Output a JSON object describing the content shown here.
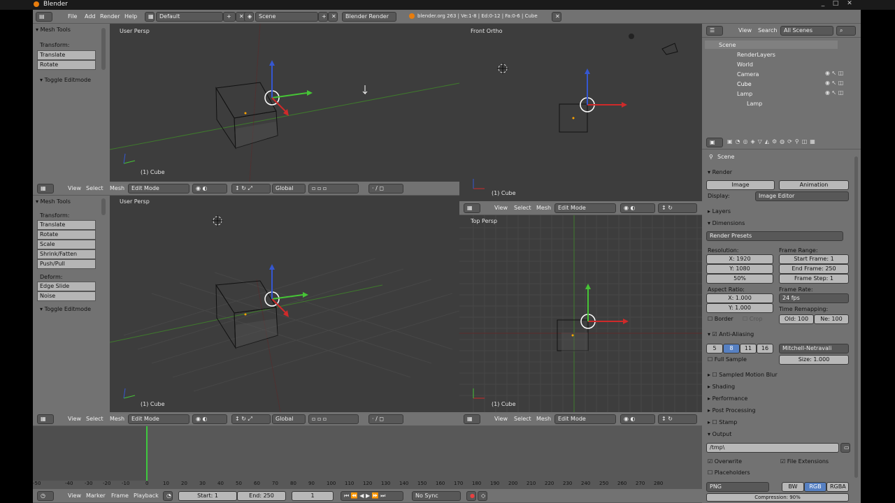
{
  "window": {
    "title": "Blender",
    "controls": [
      "_",
      "□",
      "✕"
    ]
  },
  "info_header": {
    "menus": [
      "File",
      "Add",
      "Render",
      "Help"
    ],
    "layout": "Default",
    "scene": "Scene",
    "engine": "Blender Render",
    "stats": "blender.org 263 | Ve:1-8 | Ed:0-12 | Fa:0-6 | Cube"
  },
  "viewport_tl": {
    "label": "User Persp",
    "object": "(1) Cube",
    "panel_title": "Mesh Tools",
    "transform_label": "Transform:",
    "buttons": [
      "Translate",
      "Rotate"
    ],
    "toggle": "Toggle Editmode"
  },
  "viewport_bl": {
    "label": "User Persp",
    "object": "(1) Cube",
    "panel_title": "Mesh Tools",
    "transform_label": "Transform:",
    "buttons": [
      "Translate",
      "Rotate",
      "Scale",
      "Shrink/Fatten",
      "Push/Pull"
    ],
    "deform_label": "Deform:",
    "deform_buttons": [
      "Edge Slide",
      "Noise"
    ],
    "toggle": "Toggle Editmode"
  },
  "viewport_tr": {
    "label": "Front Ortho",
    "object": "(1) Cube"
  },
  "viewport_br": {
    "label": "Top Persp",
    "object": "(1) Cube"
  },
  "vp_header": {
    "menus": [
      "View",
      "Select",
      "Mesh"
    ],
    "mode": "Edit Mode",
    "orientation": "Global"
  },
  "outliner": {
    "menus": [
      "View",
      "Search"
    ],
    "filter": "All Scenes",
    "items": [
      "Scene",
      "RenderLayers",
      "World",
      "Camera",
      "Cube",
      "Lamp",
      "Lamp"
    ]
  },
  "properties": {
    "context": "Scene",
    "render_title": "Render",
    "image_btn": "Image",
    "animation_btn": "Animation",
    "display_label": "Display:",
    "display_value": "Image Editor",
    "layers": "Layers",
    "dimensions": "Dimensions",
    "presets": "Render Presets",
    "resolution_label": "Resolution:",
    "res_x": "X: 1920",
    "res_y": "Y: 1080",
    "res_pct": "50%",
    "frame_range_label": "Frame Range:",
    "start_frame": "Start Frame: 1",
    "end_frame": "End Frame: 250",
    "frame_step": "Frame Step: 1",
    "aspect_label": "Aspect Ratio:",
    "asp_x": "X: 1.000",
    "asp_y": "Y: 1.000",
    "frame_rate_label": "Frame Rate:",
    "fps": "24 fps",
    "time_remap": "Time Remapping:",
    "border": "Border",
    "crop": "Crop",
    "old": "Old: 100",
    "new": "Ne: 100",
    "antialias": "Anti-Aliasing",
    "aa_samples": [
      "5",
      "8",
      "11",
      "16"
    ],
    "filter": "Mitchell-Netravali",
    "full_sample": "Full Sample",
    "size": "Size: 1.000",
    "sections": [
      "Sampled Motion Blur",
      "Shading",
      "Performance",
      "Post Processing",
      "Stamp",
      "Output"
    ],
    "output_path": "/tmp\\",
    "overwrite": "Overwrite",
    "file_ext": "File Extensions",
    "placeholders": "Placeholders",
    "format": "PNG",
    "color_modes": [
      "BW",
      "RGB",
      "RGBA"
    ],
    "compression": "Compression: 90%"
  },
  "timeline": {
    "ticks": [
      "-50",
      "-40",
      "-30",
      "-20",
      "-10",
      "0",
      "10",
      "20",
      "30",
      "40",
      "50",
      "60",
      "70",
      "80",
      "90",
      "100",
      "110",
      "120",
      "130",
      "140",
      "150",
      "160",
      "170",
      "180",
      "190",
      "200",
      "210",
      "220",
      "230",
      "240",
      "250",
      "260",
      "270",
      "280"
    ],
    "menus": [
      "View",
      "Marker",
      "Frame",
      "Playback"
    ],
    "start": "Start: 1",
    "end": "End: 250",
    "current": "1",
    "sync": "No Sync"
  }
}
